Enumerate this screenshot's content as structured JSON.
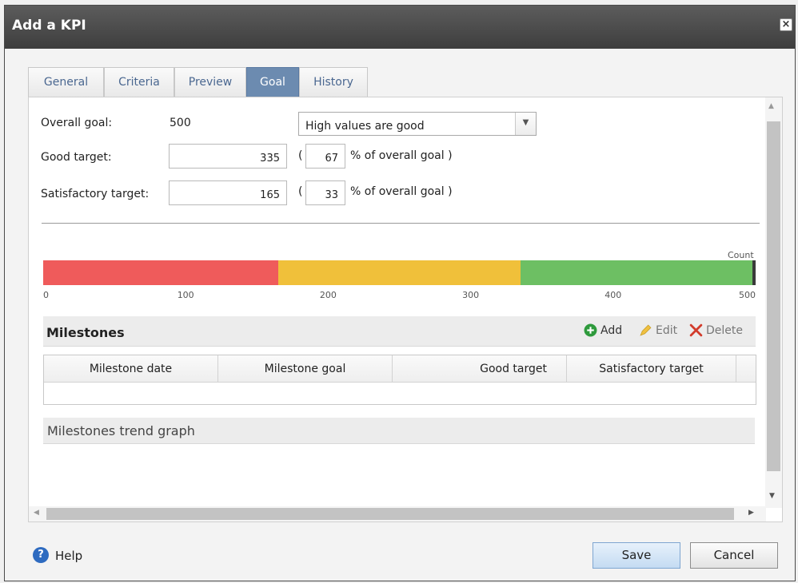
{
  "window": {
    "title": "Add a KPI"
  },
  "tabs": [
    {
      "label": "General"
    },
    {
      "label": "Criteria"
    },
    {
      "label": "Preview"
    },
    {
      "label": "Goal",
      "active": true
    },
    {
      "label": "History"
    }
  ],
  "goal": {
    "overall_label": "Overall goal:",
    "overall_value": "500",
    "direction_selected": "High values are good",
    "good_label": "Good target:",
    "good_value": "335",
    "good_pct": "67",
    "satisfactory_label": "Satisfactory target:",
    "satisfactory_value": "165",
    "satisfactory_pct": "33",
    "open_paren": "(",
    "pct_suffix": "% of overall goal )"
  },
  "gauge": {
    "count_label": "Count",
    "min": 0,
    "max": 500,
    "ticks": [
      "0",
      "100",
      "200",
      "300",
      "400",
      "500"
    ],
    "bands": [
      {
        "name": "poor",
        "from": 0,
        "to": 165,
        "color": "#ef5b5b"
      },
      {
        "name": "satisfactory",
        "from": 165,
        "to": 335,
        "color": "#f0c03a"
      },
      {
        "name": "good",
        "from": 335,
        "to": 500,
        "color": "#6dbf63"
      }
    ]
  },
  "milestones": {
    "title": "Milestones",
    "add_label": "Add",
    "edit_label": "Edit",
    "delete_label": "Delete",
    "columns": [
      "Milestone date",
      "Milestone goal",
      "Good target",
      "Satisfactory target"
    ],
    "rows": []
  },
  "trend": {
    "title": "Milestones trend graph"
  },
  "footer": {
    "help_label": "Help",
    "save_label": "Save",
    "cancel_label": "Cancel"
  },
  "colors": {
    "titlebar": "#4a4a4a",
    "active_tab": "#6c8bb0",
    "add_icon": "#2e9a3c",
    "delete_icon": "#d23b2b",
    "help_icon": "#2e6bc0"
  }
}
